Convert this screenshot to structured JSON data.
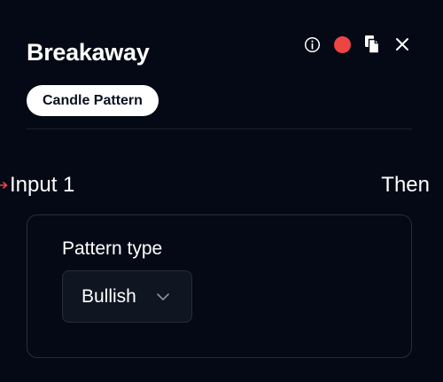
{
  "node": {
    "title": "Breakaway",
    "category_badge": "Candle Pattern",
    "status_color": "#ef4444"
  },
  "actions": [
    {
      "name": "info-icon"
    },
    {
      "name": "status-dot"
    },
    {
      "name": "copy-icon"
    },
    {
      "name": "close-icon"
    }
  ],
  "ports": {
    "input_label": "Input 1",
    "output_label": "Then",
    "input_connector_color": "#ef4444"
  },
  "config": {
    "pattern_type_label": "Pattern type",
    "pattern_type_value": "Bullish"
  }
}
